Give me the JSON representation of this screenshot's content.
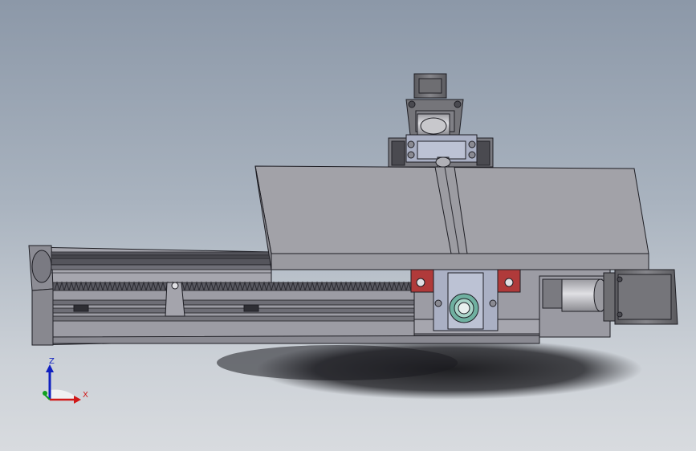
{
  "viewport": {
    "background_top": "#8c98a8",
    "background_bottom": "#d8dbdf"
  },
  "model": {
    "body_color": "#9c9ca4",
    "table_color": "#a2a2a8",
    "edge_color": "#1e1e24",
    "motor_color": "#6e6e72",
    "bearing_color": "#aab0c4",
    "block_accent": "#b03a3a",
    "ring_accent": "#6fb0a0"
  },
  "triad": {
    "z_label": "Z",
    "x_label": "X",
    "z_color": "#1020c0",
    "x_color": "#d01818",
    "y_color": "#10a020"
  }
}
